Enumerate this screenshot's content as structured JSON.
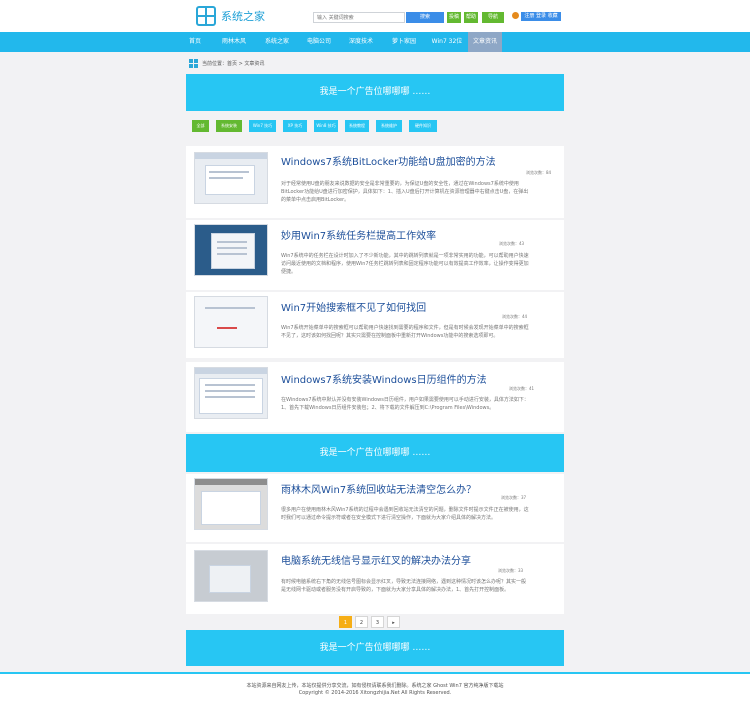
{
  "header": {
    "logo_text": "系统之家",
    "search_placeholder": "输入 关键词搜索",
    "search_button": "搜索",
    "mini_buttons": [
      "投稿",
      "帮助",
      "导航"
    ],
    "user_button": "注册 登录 收藏"
  },
  "nav": {
    "items": [
      "首页",
      "雨林木风",
      "系统之家",
      "电脑公司",
      "深度技术",
      "萝卜家园",
      "Win7 32位",
      "文章资讯"
    ],
    "active_index": 7
  },
  "breadcrumb": {
    "text": "当前位置：首页 > 文章资讯"
  },
  "ad": {
    "text": "我是一个广告位哪哪哪 ……"
  },
  "tags": [
    {
      "label": "全部",
      "color": "#63b931"
    },
    {
      "label": "系统安装",
      "color": "#63b931"
    },
    {
      "label": "Win7 技巧",
      "color": "#27c6f3"
    },
    {
      "label": "XP 技巧",
      "color": "#27c6f3"
    },
    {
      "label": "Win8 技巧",
      "color": "#27c6f3"
    },
    {
      "label": "系统教程",
      "color": "#27c6f3"
    },
    {
      "label": "系统维护",
      "color": "#27c6f3"
    },
    {
      "label": "硬件知识",
      "color": "#27c6f3"
    }
  ],
  "articles": [
    {
      "title": "Windows7系统BitLocker功能给U盘加密的方法",
      "meta": "浏览次数：84",
      "summary": "对于经常使用U盘的朋友来说数据的安全是非常重要的，为保证U盘的安全性，通过在Windows7系统中使用BitLocker功能给U盘进行加密保护，具体如下：1、插入U盘后打开计算机在资源管理器中右键点击U盘，在弹出的菜单中点击启用BitLocker。"
    },
    {
      "title": "妙用Win7系统任务栏提高工作效率",
      "meta": "浏览次数：43",
      "summary": "Win7系统中的任务栏在设计时加入了不少新功能，其中的跳转列表就是一项非常实用的功能，可以帮助用户快速访问最近使用的文档和程序，使用Win7任务栏跳转列表和固定程序功能可以有效提高工作效率，让操作变得更加便捷。"
    },
    {
      "title": "Win7开始搜索框不见了如何找回",
      "meta": "浏览次数：44",
      "summary": "Win7系统开始菜单中的搜索框可以帮助用户快速找到需要的程序和文件，但是有时候会发现开始菜单中的搜索框不见了，这时该如何找回呢？其实只需要在控制面板中重新打开Windows功能中的搜索选项即可。"
    },
    {
      "title": "Windows7系统安装Windows日历组件的方法",
      "meta": "浏览次数：41",
      "summary": "在Windows7系统中默认并没有安装Windows日历组件，用户如果需要使用可以手动进行安装，具体方法如下：1、首先下载Windows日历组件安装包；2、将下载的文件解压到C:\\Program Files\\Windows。"
    },
    {
      "title": "雨林木风Win7系统回收站无法清空怎么办？",
      "meta": "浏览次数：37",
      "summary": "很多用户在使用雨林木风Win7系统的过程中会遇到回收站无法清空的问题，删除文件时提示文件正在被使用，这时我们可以通过命令提示符或者在安全模式下进行清空操作，下面就为大家介绍具体的解决方法。"
    },
    {
      "title": "电脑系统无线信号显示红叉的解决办法分享",
      "meta": "浏览次数：33",
      "summary": "有时候电脑系统右下角的无线信号图标会显示红叉，导致无法连接网络，遇到这种情况时该怎么办呢？其实一般是无线网卡驱动或者服务没有开启导致的，下面就为大家分享具体的解决办法，1、首先打开控制面板。"
    }
  ],
  "pager": {
    "pages": [
      "1",
      "2",
      "3",
      "▸"
    ],
    "current": "1"
  },
  "footer": {
    "line1": "本站资源来自网友上传，本站仅提供分享交流，如有侵权请联系我们删除。系统之家 Ghost Win7 官方纯净版下载站",
    "line2": "Copyright © 2014-2016 Xitongzhijia.Net All Rights Reserved."
  }
}
